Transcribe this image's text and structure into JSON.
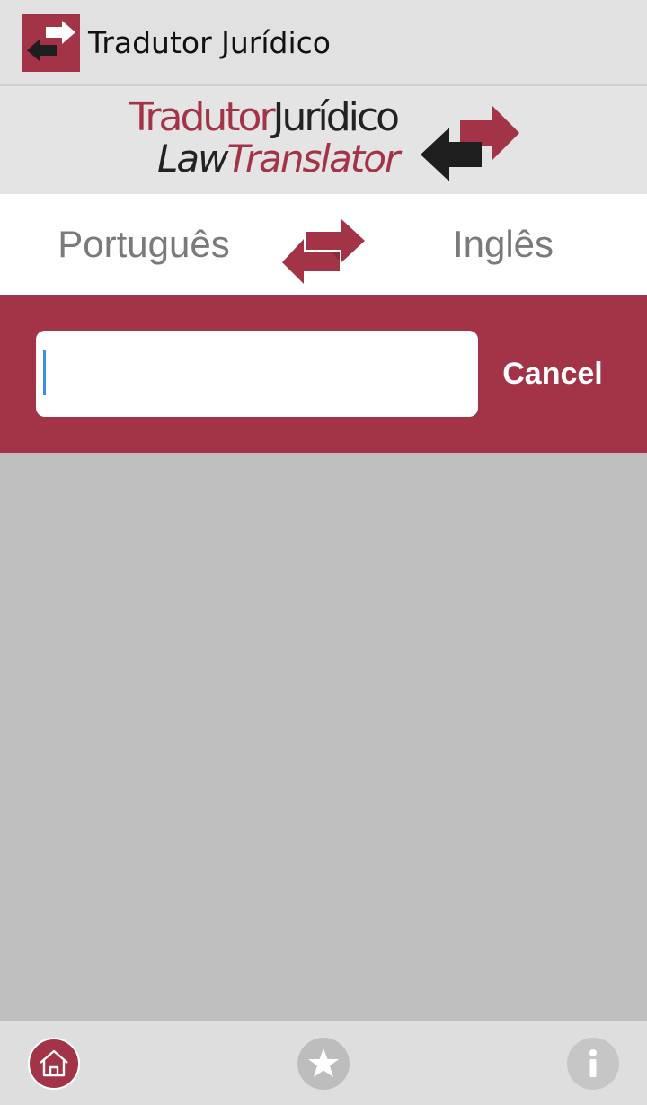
{
  "app_bar": {
    "title": "Tradutor Jurídico"
  },
  "logo": {
    "line1_part1": "Tradutor",
    "line1_part2": "Jurídico",
    "line2_part1": "Law",
    "line2_part2": "Translator"
  },
  "language": {
    "from": "Português",
    "to": "Inglês"
  },
  "search": {
    "value": "",
    "cancel_label": "Cancel"
  },
  "bottom_nav": {
    "icons": [
      "home-icon",
      "star-icon",
      "info-icon"
    ]
  },
  "colors": {
    "brand": "#a33448",
    "logo_dark": "#222222",
    "background": "#bfbfbf"
  }
}
